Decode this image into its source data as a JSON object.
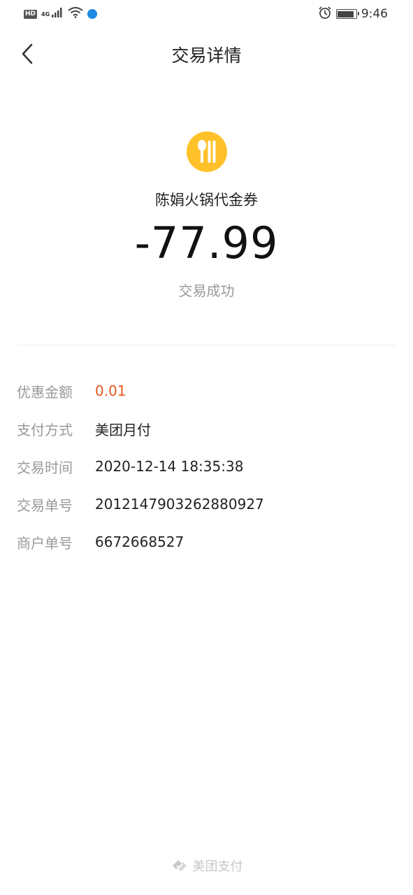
{
  "status_bar": {
    "hd": "HD",
    "network": "4G",
    "time": "9:46",
    "icons": [
      "signal-icon",
      "wifi-icon",
      "app-notification-icon",
      "alarm-icon",
      "battery-icon"
    ]
  },
  "nav": {
    "title": "交易详情",
    "back_icon": "chevron-left-icon"
  },
  "transaction": {
    "merchant_icon": "utensils-icon",
    "merchant_name": "陈娟火锅代金券",
    "amount": "-77.99",
    "status": "交易成功"
  },
  "details": [
    {
      "label": "优惠金额",
      "value": "0.01"
    },
    {
      "label": "支付方式",
      "value": "美团月付"
    },
    {
      "label": "交易时间",
      "value": "2020-12-14 18:35:38"
    },
    {
      "label": "交易单号",
      "value": "2012147903262880927"
    },
    {
      "label": "商户单号",
      "value": "6672668527"
    }
  ],
  "footer": {
    "brand": "美团支付"
  },
  "colors": {
    "accent_yellow": "#FFC12A",
    "discount_orange": "#E8561F",
    "label_gray": "#999999",
    "text_dark": "#222222"
  }
}
